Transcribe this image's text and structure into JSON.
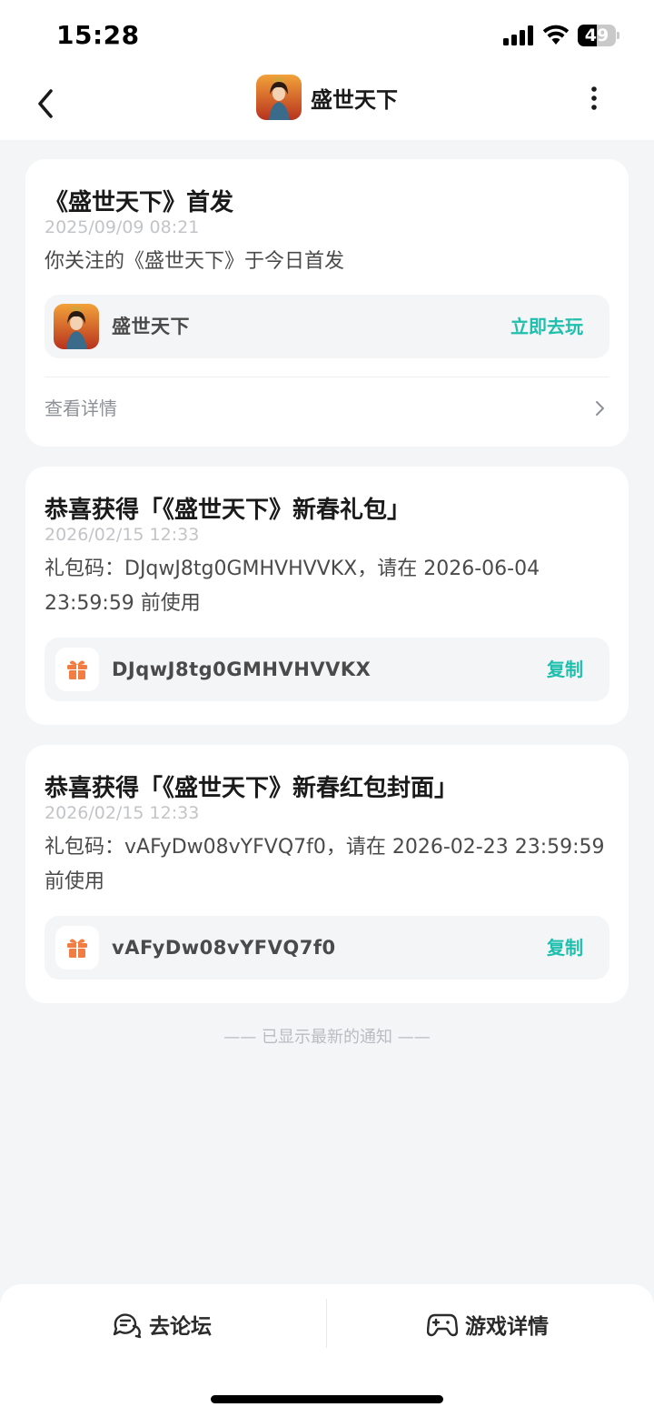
{
  "status_bar": {
    "time": "15:28",
    "battery_level": "49",
    "battery_fraction": 0.49,
    "icons": [
      "cellular-signal-icon",
      "wifi-icon",
      "battery-icon"
    ]
  },
  "nav": {
    "title": "盛世天下",
    "back_icon": "chevron-left-icon",
    "more_icon": "more-vertical-icon"
  },
  "notifications": [
    {
      "title": "《盛世天下》首发",
      "time": "2025/09/09 08:21",
      "body": "你关注的《盛世天下》于今日首发",
      "item_name": "盛世天下",
      "action": "立即去玩",
      "detail_label": "查看详情"
    },
    {
      "title": "恭喜获得「《盛世天下》新春礼包」",
      "time": "2026/02/15 12:33",
      "body": "礼包码：DJqwJ8tg0GMHVHVVKX，请在 2026-06-04 23:59:59 前使用",
      "code": "DJqwJ8tg0GMHVHVVKX",
      "action": "复制"
    },
    {
      "title": "恭喜获得「《盛世天下》新春红包封面」",
      "time": "2026/02/15 12:33",
      "body": "礼包码：vAFyDw08vYFVQ7f0，请在 2026-02-23 23:59:59 前使用",
      "code": "vAFyDw08vYFVQ7f0",
      "action": "复制"
    }
  ],
  "end_note": "—— 已显示最新的通知 ——",
  "bottom_bar": {
    "forum_label": "去论坛",
    "game_detail_label": "游戏详情"
  },
  "colors": {
    "accent": "#1fbfae",
    "gift_orange": "#f27d42",
    "background": "#f4f5f7"
  }
}
